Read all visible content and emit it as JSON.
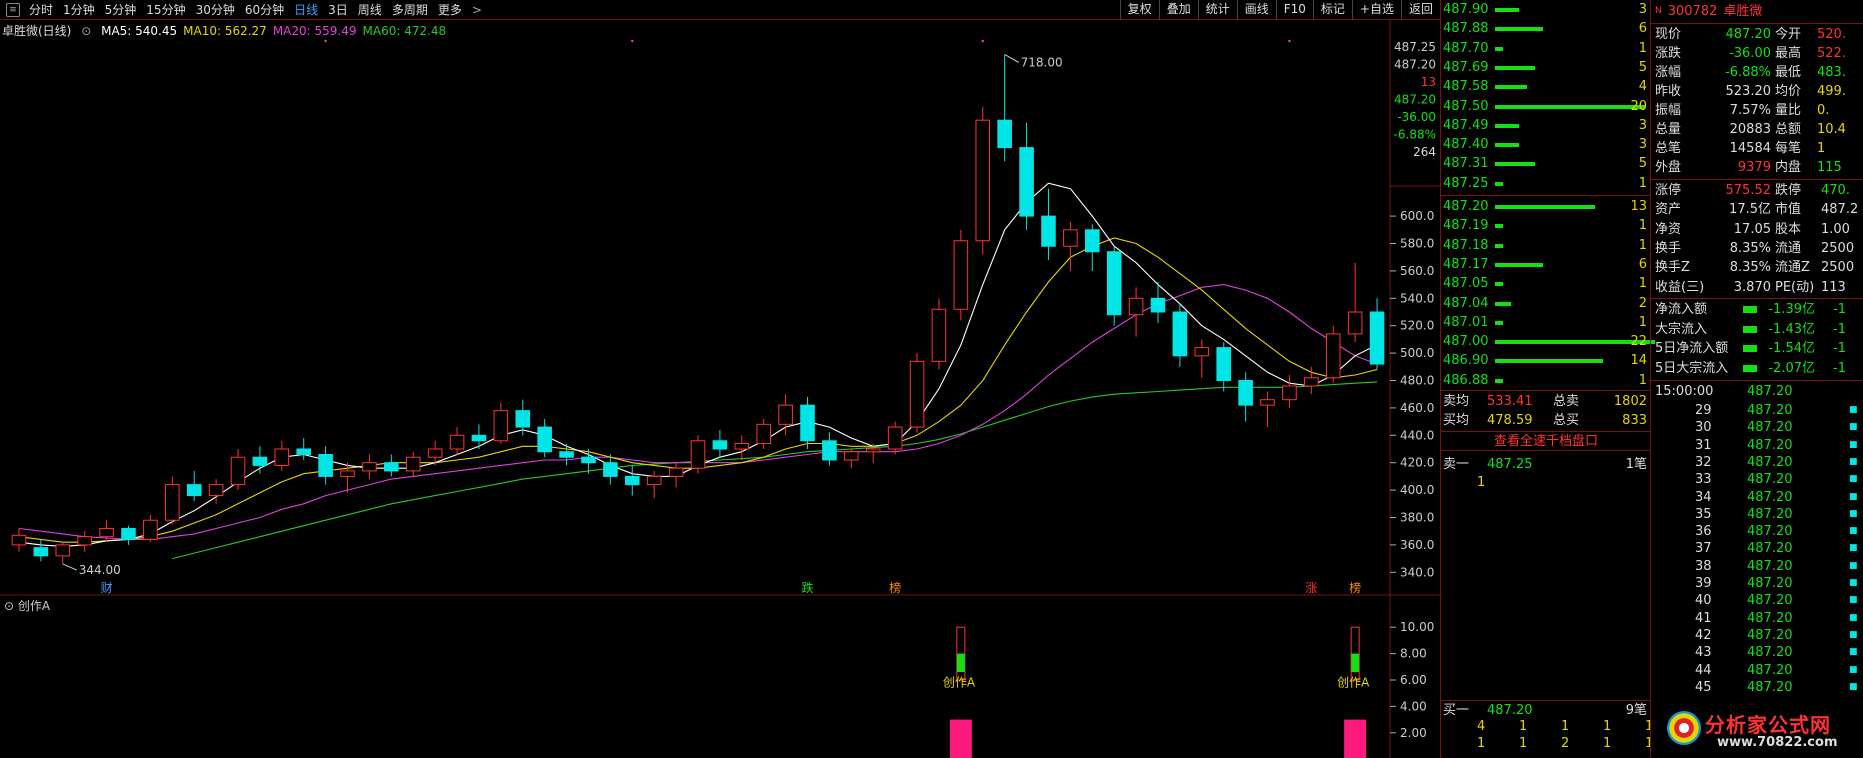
{
  "toolbar": {
    "periods": [
      "分时",
      "1分钟",
      "5分钟",
      "15分钟",
      "30分钟",
      "60分钟",
      "日线",
      "3日",
      "周线",
      "多周期",
      "更多"
    ],
    "active": "日线",
    "right": [
      "复权",
      "叠加",
      "统计",
      "画线",
      "F10",
      "标记",
      "+自选",
      "返回"
    ]
  },
  "chart_title": "卓胜微(日线)",
  "ma_legend": [
    {
      "label": "MA5: 540.45",
      "color": "#ffffff"
    },
    {
      "label": "MA10: 562.27",
      "color": "#e8d400"
    },
    {
      "label": "MA20: 559.49",
      "color": "#e040e0"
    },
    {
      "label": "MA60: 472.48",
      "color": "#28c828"
    }
  ],
  "price_axis_labels": [
    "600.0",
    "580.0",
    "560.0",
    "540.0",
    "520.0",
    "500.0",
    "480.0",
    "460.0",
    "440.0",
    "420.0",
    "400.0",
    "380.0",
    "360.0",
    "340.0"
  ],
  "price_axis_top": [
    "487.25",
    "487.20",
    "13",
    "487.20",
    "-36.00",
    "-6.88%",
    "264"
  ],
  "max_label": "718.00",
  "min_label": "344.00",
  "event_markers": [
    {
      "text": "财",
      "color": "#3aa0ff",
      "idx": 4
    },
    {
      "text": "跌",
      "color": "#12e012",
      "idx": 36
    },
    {
      "text": "榜",
      "color": "#ff8c00",
      "idx": 40
    },
    {
      "text": "涨",
      "color": "#ff3232",
      "idx": 59
    },
    {
      "text": "榜",
      "color": "#ff8c00",
      "idx": 61
    }
  ],
  "indicator": {
    "name": "创作A",
    "axis": [
      "10.00",
      "8.00",
      "6.00",
      "4.00",
      "2.00"
    ],
    "signals": [
      {
        "idx": 43,
        "label": "创作A"
      },
      {
        "idx": 61,
        "label": "创作A"
      }
    ]
  },
  "chart_data": {
    "type": "candlestick",
    "ylim": [
      330,
      730
    ],
    "ohlc": [
      [
        360,
        372,
        355,
        367
      ],
      [
        358,
        364,
        348,
        352
      ],
      [
        352,
        362,
        346,
        360
      ],
      [
        360,
        370,
        355,
        366
      ],
      [
        366,
        378,
        362,
        372
      ],
      [
        372,
        374,
        360,
        364
      ],
      [
        364,
        382,
        362,
        378
      ],
      [
        378,
        410,
        375,
        404
      ],
      [
        404,
        414,
        392,
        396
      ],
      [
        396,
        408,
        390,
        404
      ],
      [
        404,
        430,
        400,
        424
      ],
      [
        424,
        432,
        412,
        418
      ],
      [
        418,
        436,
        414,
        430
      ],
      [
        430,
        438,
        422,
        426
      ],
      [
        426,
        432,
        404,
        410
      ],
      [
        410,
        420,
        398,
        414
      ],
      [
        414,
        426,
        408,
        420
      ],
      [
        420,
        426,
        410,
        414
      ],
      [
        414,
        428,
        410,
        424
      ],
      [
        424,
        436,
        418,
        430
      ],
      [
        430,
        446,
        426,
        440
      ],
      [
        440,
        448,
        430,
        436
      ],
      [
        436,
        464,
        434,
        458
      ],
      [
        458,
        466,
        440,
        446
      ],
      [
        446,
        452,
        424,
        428
      ],
      [
        428,
        434,
        418,
        424
      ],
      [
        424,
        430,
        412,
        420
      ],
      [
        420,
        426,
        404,
        410
      ],
      [
        410,
        418,
        396,
        404
      ],
      [
        404,
        414,
        394,
        410
      ],
      [
        410,
        420,
        402,
        416
      ],
      [
        416,
        440,
        412,
        436
      ],
      [
        436,
        444,
        424,
        430
      ],
      [
        430,
        440,
        422,
        434
      ],
      [
        434,
        452,
        430,
        448
      ],
      [
        448,
        470,
        440,
        462
      ],
      [
        462,
        468,
        430,
        436
      ],
      [
        436,
        442,
        418,
        422
      ],
      [
        422,
        430,
        416,
        428
      ],
      [
        428,
        434,
        420,
        430
      ],
      [
        430,
        450,
        426,
        446
      ],
      [
        446,
        500,
        442,
        494
      ],
      [
        494,
        540,
        488,
        532
      ],
      [
        532,
        590,
        524,
        582
      ],
      [
        582,
        680,
        572,
        670
      ],
      [
        670,
        718,
        640,
        650
      ],
      [
        650,
        668,
        590,
        600
      ],
      [
        600,
        620,
        568,
        578
      ],
      [
        578,
        596,
        560,
        590
      ],
      [
        590,
        594,
        560,
        574
      ],
      [
        574,
        578,
        520,
        528
      ],
      [
        528,
        548,
        512,
        540
      ],
      [
        540,
        552,
        522,
        530
      ],
      [
        530,
        536,
        490,
        498
      ],
      [
        498,
        510,
        482,
        504
      ],
      [
        504,
        508,
        472,
        480
      ],
      [
        480,
        486,
        450,
        462
      ],
      [
        462,
        472,
        446,
        466
      ],
      [
        466,
        484,
        460,
        476
      ],
      [
        476,
        490,
        470,
        482
      ],
      [
        482,
        520,
        478,
        514
      ],
      [
        514,
        566,
        508,
        530
      ],
      [
        530,
        540,
        488,
        492
      ]
    ],
    "ma5": [
      362,
      360,
      359,
      360,
      363,
      364,
      368,
      377,
      385,
      395,
      406,
      416,
      424,
      426,
      422,
      418,
      416,
      416,
      416,
      420,
      426,
      432,
      440,
      444,
      440,
      432,
      426,
      418,
      412,
      410,
      410,
      418,
      424,
      428,
      436,
      446,
      450,
      446,
      438,
      432,
      434,
      450,
      474,
      506,
      550,
      590,
      610,
      624,
      620,
      600,
      578,
      566,
      550,
      536,
      520,
      510,
      498,
      486,
      478,
      476,
      484,
      498,
      506
    ],
    "ma10": [
      366,
      364,
      362,
      362,
      363,
      364,
      366,
      370,
      376,
      382,
      390,
      398,
      406,
      412,
      414,
      416,
      418,
      420,
      420,
      420,
      422,
      424,
      428,
      432,
      432,
      430,
      428,
      424,
      420,
      418,
      416,
      416,
      418,
      420,
      424,
      430,
      434,
      434,
      432,
      432,
      434,
      440,
      450,
      462,
      480,
      506,
      530,
      552,
      570,
      578,
      584,
      580,
      570,
      558,
      546,
      532,
      518,
      506,
      494,
      486,
      482,
      484,
      488
    ],
    "ma20": [
      372,
      370,
      368,
      366,
      365,
      364,
      364,
      366,
      368,
      372,
      376,
      380,
      386,
      390,
      396,
      400,
      404,
      408,
      410,
      412,
      414,
      416,
      418,
      420,
      422,
      422,
      424,
      424,
      422,
      420,
      420,
      420,
      420,
      420,
      422,
      424,
      426,
      428,
      428,
      428,
      428,
      430,
      434,
      440,
      448,
      458,
      470,
      484,
      496,
      508,
      518,
      528,
      536,
      542,
      548,
      550,
      546,
      540,
      530,
      518,
      508,
      498,
      492
    ],
    "ma60": [
      null,
      null,
      null,
      null,
      null,
      null,
      null,
      350,
      354,
      358,
      362,
      366,
      370,
      374,
      378,
      382,
      386,
      390,
      393,
      396,
      399,
      402,
      405,
      408,
      410,
      412,
      414,
      416,
      418,
      419,
      420,
      421,
      422,
      423,
      424,
      426,
      428,
      429,
      430,
      431,
      432,
      434,
      437,
      441,
      446,
      451,
      456,
      461,
      465,
      468,
      470,
      471,
      472,
      473,
      474,
      475,
      475,
      475,
      475,
      476,
      477,
      478,
      479
    ]
  },
  "sell_book": [
    {
      "p": "487.90",
      "v": "3",
      "w": 24
    },
    {
      "p": "487.88",
      "v": "6",
      "w": 48
    },
    {
      "p": "487.70",
      "v": "1",
      "w": 8
    },
    {
      "p": "487.69",
      "v": "5",
      "w": 40
    },
    {
      "p": "487.58",
      "v": "4",
      "w": 32
    },
    {
      "p": "487.50",
      "v": "20",
      "w": 150
    },
    {
      "p": "487.49",
      "v": "3",
      "w": 24
    },
    {
      "p": "487.40",
      "v": "3",
      "w": 24
    },
    {
      "p": "487.31",
      "v": "5",
      "w": 40
    },
    {
      "p": "487.25",
      "v": "1",
      "w": 8
    }
  ],
  "buy_book": [
    {
      "p": "487.20",
      "v": "13",
      "w": 100
    },
    {
      "p": "487.19",
      "v": "1",
      "w": 8
    },
    {
      "p": "487.18",
      "v": "1",
      "w": 8
    },
    {
      "p": "487.17",
      "v": "6",
      "w": 48
    },
    {
      "p": "487.05",
      "v": "1",
      "w": 8
    },
    {
      "p": "487.04",
      "v": "2",
      "w": 16
    },
    {
      "p": "487.01",
      "v": "1",
      "w": 8
    },
    {
      "p": "487.00",
      "v": "22",
      "w": 160
    },
    {
      "p": "486.90",
      "v": "14",
      "w": 108
    },
    {
      "p": "486.88",
      "v": "1",
      "w": 8
    }
  ],
  "avg": [
    {
      "k": "卖均",
      "v": "533.41",
      "k2": "总卖",
      "v2": "1802"
    },
    {
      "k": "买均",
      "v": "478.59",
      "k2": "总买",
      "v2": "833"
    }
  ],
  "level2_btn": "查看全速千档盘口",
  "sell1": {
    "k": "卖一",
    "p": "487.25",
    "n": "1笔",
    "q": "1"
  },
  "buy1": {
    "k": "买一",
    "p": "487.20",
    "n": "9笔"
  },
  "buy1_qty": [
    [
      "4",
      "1",
      "1",
      "1",
      "1"
    ],
    [
      "1",
      "1",
      "2",
      "1",
      "1"
    ]
  ],
  "stock": {
    "code": "300782",
    "name": "卓胜微"
  },
  "quote": [
    [
      "现价",
      "487.20",
      "今开",
      "520."
    ],
    [
      "涨跌",
      "-36.00",
      "最高",
      "522."
    ],
    [
      "涨幅",
      "-6.88%",
      "最低",
      "483."
    ],
    [
      "昨收",
      "523.20",
      "均价",
      "499."
    ],
    [
      "振幅",
      "7.57%",
      "量比",
      "0."
    ],
    [
      "总量",
      "20883",
      "总额",
      "10.4"
    ],
    [
      "总笔",
      "14584",
      "每笔",
      "1"
    ],
    [
      "外盘",
      "9379",
      "内盘",
      "115"
    ]
  ],
  "finance": [
    [
      "涨停",
      "575.52",
      "跌停",
      "470."
    ],
    [
      "资产",
      "17.5亿",
      "市值",
      "487.2"
    ],
    [
      "净资",
      "17.05",
      "股本",
      "1.00"
    ],
    [
      "换手",
      "8.35%",
      "流通",
      "2500"
    ],
    [
      "换手Z",
      "8.35%",
      "流通Z",
      "2500"
    ],
    [
      "收益(三)",
      "3.870",
      "PE(动)",
      "113"
    ]
  ],
  "flows": [
    {
      "k": "净流入额",
      "v": "-1.39亿",
      "t": "-1"
    },
    {
      "k": "大宗流入",
      "v": "-1.43亿",
      "t": "-1"
    },
    {
      "k": "5日净流入额",
      "v": "-1.54亿",
      "t": "-1"
    },
    {
      "k": "5日大宗流入",
      "v": "-2.07亿",
      "t": "-1"
    }
  ],
  "ticks_time": "15:00:00",
  "ticks_price": "487.20",
  "ticks_minutes": [
    "29",
    "30",
    "31",
    "32",
    "33",
    "34",
    "35",
    "36",
    "37",
    "38",
    "39",
    "40",
    "41",
    "42",
    "43",
    "44",
    "45"
  ],
  "watermark": {
    "brand": "分析家公式网",
    "url": "www.70822.com"
  }
}
